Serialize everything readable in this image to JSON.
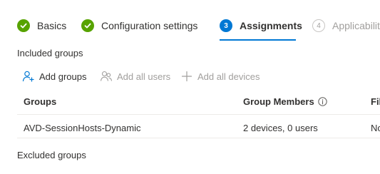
{
  "wizard": {
    "steps": [
      {
        "number": "1",
        "label": "Basics",
        "state": "done"
      },
      {
        "number": "2",
        "label": "Configuration settings",
        "state": "done"
      },
      {
        "number": "3",
        "label": "Assignments",
        "state": "current"
      },
      {
        "number": "4",
        "label": "Applicabilit",
        "state": "future"
      }
    ]
  },
  "included_section": {
    "title": "Included groups",
    "toolbar": {
      "add_groups": "Add groups",
      "add_all_users": "Add all users",
      "add_all_devices": "Add all devices"
    },
    "table": {
      "columns": [
        "Groups",
        "Group Members",
        "Fil"
      ],
      "rows": [
        {
          "group": "AVD-SessionHosts-Dynamic",
          "members": "2 devices, 0 users",
          "filter": "No"
        }
      ]
    }
  },
  "excluded_section": {
    "title": "Excluded groups"
  },
  "colors": {
    "accent": "#0078d4",
    "success": "#57a300",
    "disabled": "#a19f9d",
    "text": "#323130",
    "divider": "#edebe9"
  },
  "icons": {
    "step_done": "checkmark-icon",
    "add_groups": "add-user-icon",
    "add_all_users": "people-icon",
    "add_all_devices": "plus-icon",
    "members_info": "info-icon"
  }
}
